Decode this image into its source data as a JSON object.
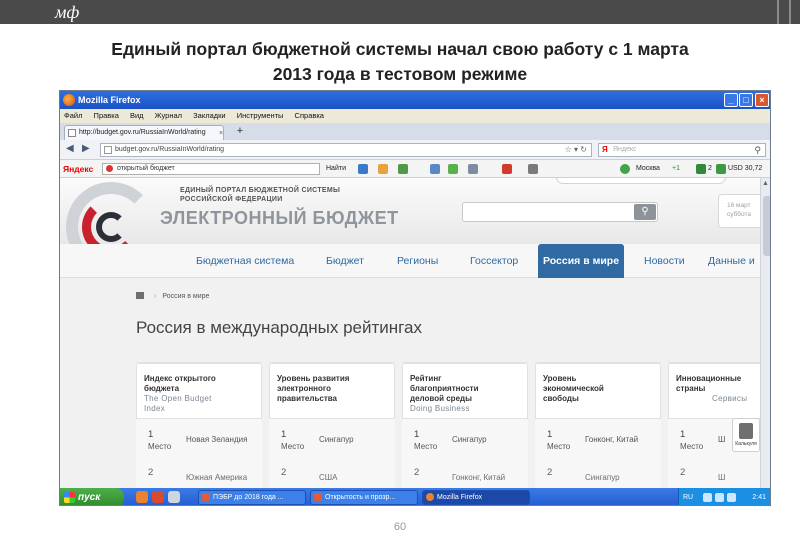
{
  "slide": {
    "logo": "мф",
    "headline_line1": "Единый портал бюджетной системы начал свою работу с 1 марта",
    "headline_line2": "2013 года в тестовом режиме",
    "page_number": "60"
  },
  "browser": {
    "window_title": "Mozilla Firefox",
    "menu": [
      "Файл",
      "Правка",
      "Вид",
      "Журнал",
      "Закладки",
      "Инструменты",
      "Справка"
    ],
    "tab_title": "http://budget.gov.ru/RussiaInWorld/rating",
    "tab_close": "×",
    "new_tab": "+",
    "url": "budget.gov.ru/RussiaInWorld/rating",
    "search_placeholder": "Яндекс",
    "yandex": {
      "logo": "Яндекс",
      "input_value": "открытый бюджет",
      "find_label": "Найти",
      "weather": "Москва",
      "temperature": "+1",
      "mail_count": "2",
      "currency": "USD 30,72"
    }
  },
  "site": {
    "header_sub_line1": "ЕДИНЫЙ ПОРТАЛ БЮДЖЕТНОЙ СИСТЕМЫ",
    "header_sub_line2": "РОССИЙСКОЙ ФЕДЕРАЦИИ",
    "header_title": "ЭЛЕКТРОННЫЙ БЮДЖЕТ",
    "date_line1": "16 март",
    "date_line2": "суббота",
    "nav": [
      "Бюджетная система",
      "Бюджет",
      "Регионы",
      "Госсектор",
      "Россия в мире",
      "Новости",
      "Данные и"
    ],
    "nav_active_index": 4,
    "breadcrumb": "Россия в мире",
    "page_title": "Россия в международных рейтингах",
    "cards": [
      {
        "title_line1": "Индекс открытого",
        "title_line2": "бюджета",
        "en_line1": "The Open Budget",
        "en_line2": "Index",
        "rows": [
          {
            "num": "1",
            "mesto": "Место",
            "country": "Новая Зеландия"
          },
          {
            "num": "2",
            "mesto": "",
            "country": "Южная Америка"
          }
        ]
      },
      {
        "title_line1": "Уровень развития",
        "title_line2": "электронного",
        "title_line3": "правительства",
        "rows": [
          {
            "num": "1",
            "mesto": "Место",
            "country": "Сингапур"
          },
          {
            "num": "2",
            "mesto": "",
            "country": "США"
          }
        ]
      },
      {
        "title_line1": "Рейтинг",
        "title_line2": "благоприятности",
        "title_line3": "деловой среды",
        "en_line1": "Doing Business",
        "rows": [
          {
            "num": "1",
            "mesto": "Место",
            "country": "Сингапур"
          },
          {
            "num": "2",
            "mesto": "",
            "country": "Гонконг, Китай"
          }
        ]
      },
      {
        "title_line1": "Уровень",
        "title_line2": "экономической",
        "title_line3": "свободы",
        "rows": [
          {
            "num": "1",
            "mesto": "Место",
            "country": "Гонконг, Китай"
          },
          {
            "num": "2",
            "mesto": "",
            "country": "Сингапур"
          }
        ]
      },
      {
        "title_line1": "Инновационные",
        "title_line2": "страны",
        "extra": "Сервисы",
        "rows": [
          {
            "num": "1",
            "mesto": "Место",
            "country": "Ш"
          },
          {
            "num": "2",
            "mesto": "",
            "country": "Ш"
          }
        ]
      }
    ],
    "calc_label": "Калькуля"
  },
  "taskbar": {
    "start": "пуск",
    "tasks": [
      "ПЭБР до 2018 года ...",
      "Открытость и прозр...",
      "Mozilla Firefox"
    ],
    "active_task_index": 2,
    "lang": "RU",
    "clock": "2:41"
  }
}
